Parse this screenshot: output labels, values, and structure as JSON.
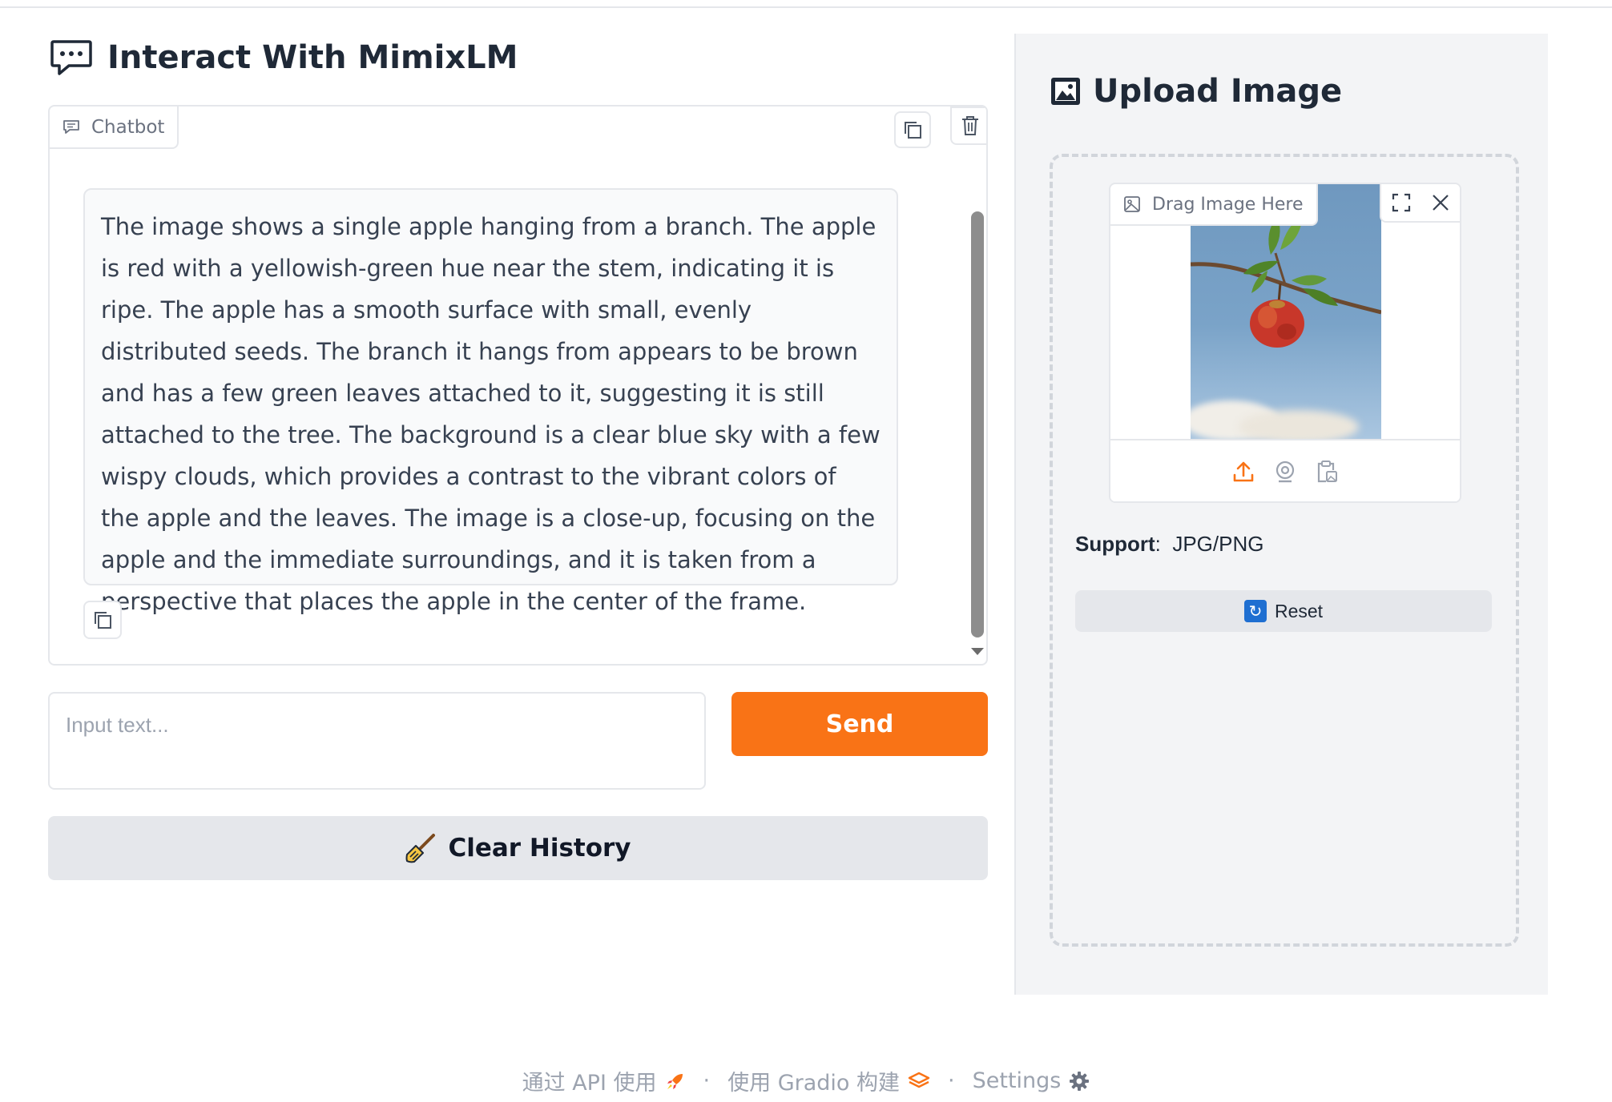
{
  "chat": {
    "title": "Interact With MimixLM",
    "chatbot_label": "Chatbot",
    "message": "The image shows a single apple hanging from a branch. The apple is red with a yellowish-green hue near the stem, indicating it is ripe. The apple has a smooth surface with small, evenly distributed seeds. The branch it hangs from appears to be brown and has a few green leaves attached to it, suggesting it is still attached to the tree. The background is a clear blue sky with a few wispy clouds, which provides a contrast to the vibrant colors of the apple and the leaves. The image is a close-up, focusing on the apple and the immediate surroundings, and it is taken from a perspective that places the apple in the center of the frame.",
    "input_placeholder": "Input text...",
    "input_value": "",
    "send_label": "Send",
    "clear_label": "Clear History"
  },
  "upload": {
    "title": "Upload Image",
    "drag_label": "Drag Image Here",
    "support_label": "Support",
    "support_sep": ":",
    "support_value": "JPG/PNG",
    "reset_label": "Reset"
  },
  "footer": {
    "api_label": "通过 API 使用",
    "built_label": "使用 Gradio 构建",
    "settings_label": "Settings",
    "separator": "·"
  },
  "colors": {
    "accent": "#f97316",
    "button_gray": "#e5e7eb",
    "panel_bg": "#f3f4f6"
  },
  "icons": [
    "chat-bubble-icon",
    "chatbot-label-icon",
    "copy-icon",
    "trash-icon",
    "picture-frame-icon",
    "image-label-icon",
    "fullscreen-icon",
    "close-icon",
    "upload-icon",
    "webcam-icon",
    "clipboard-icon",
    "broom-icon",
    "refresh-icon",
    "rocket-icon",
    "gradio-logo-icon",
    "gear-icon"
  ]
}
